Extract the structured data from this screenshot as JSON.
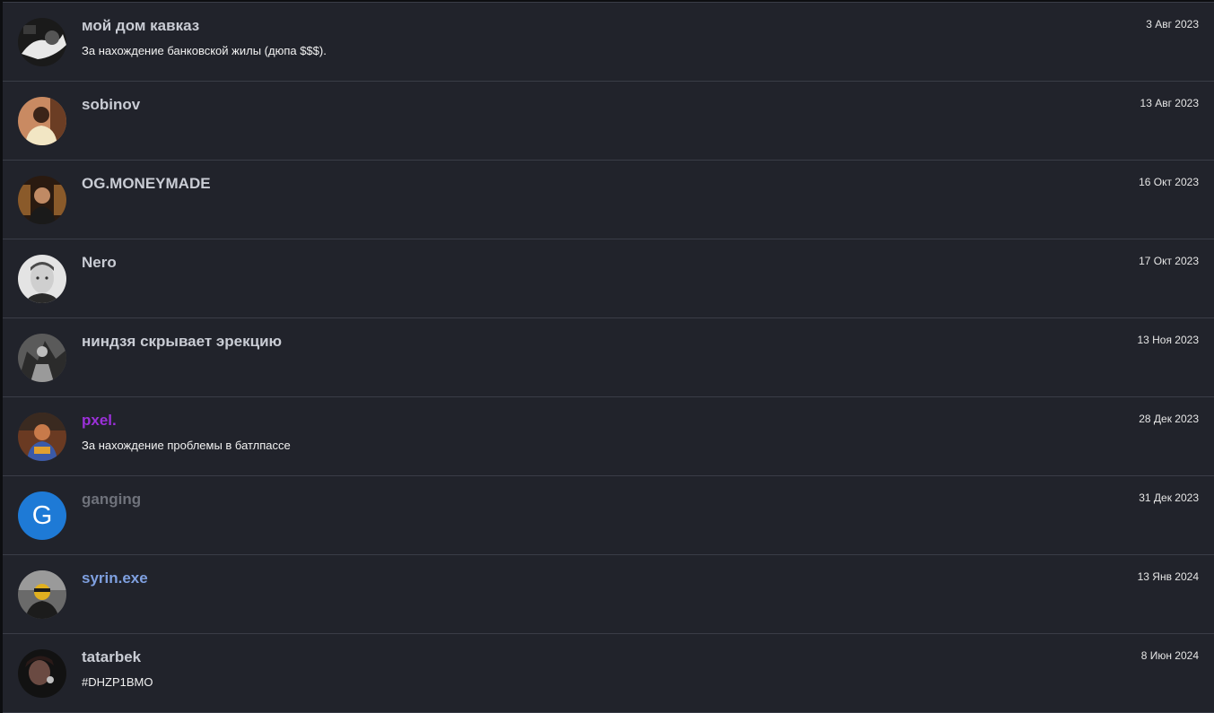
{
  "members": [
    {
      "name": "мой дом кавказ",
      "description": "За нахождение банковской жилы (дюпа $$$).",
      "date": "3 Авг 2023",
      "avatar": "photo-avatar-icon",
      "name_color": "#c9ccd4"
    },
    {
      "name": "sobinov",
      "description": "",
      "date": "13 Авг 2023",
      "avatar": "photo-avatar-icon",
      "name_color": "#c9ccd4"
    },
    {
      "name": "OG.MONEYMADE",
      "description": "",
      "date": "16 Окт 2023",
      "avatar": "photo-avatar-icon",
      "name_color": "#c9ccd4"
    },
    {
      "name": "Nero",
      "description": "",
      "date": "17 Окт 2023",
      "avatar": "photo-avatar-icon",
      "name_color": "#c9ccd4"
    },
    {
      "name": "ниндзя скрывает эрекцию",
      "description": "",
      "date": "13 Ноя 2023",
      "avatar": "photo-avatar-icon",
      "name_color": "#c9ccd4"
    },
    {
      "name": "pxel.",
      "description": "За нахождение проблемы в батлпассе",
      "date": "28 Дек 2023",
      "avatar": "photo-avatar-icon",
      "name_color": "#9b30d9"
    },
    {
      "name": "ganging",
      "description": "",
      "date": "31 Дек 2023",
      "avatar": "letter-avatar-icon",
      "avatar_letter": "G",
      "avatar_color": "#1e7ad6",
      "name_color": "#6f727b"
    },
    {
      "name": "syrin.exe",
      "description": "",
      "date": "13 Янв 2024",
      "avatar": "photo-avatar-icon",
      "name_color": "#7fa0e0"
    },
    {
      "name": "tatarbek",
      "description": "#DHZP1BMO",
      "date": "8 Июн 2024",
      "avatar": "photo-avatar-icon",
      "name_color": "#c9ccd4"
    }
  ]
}
